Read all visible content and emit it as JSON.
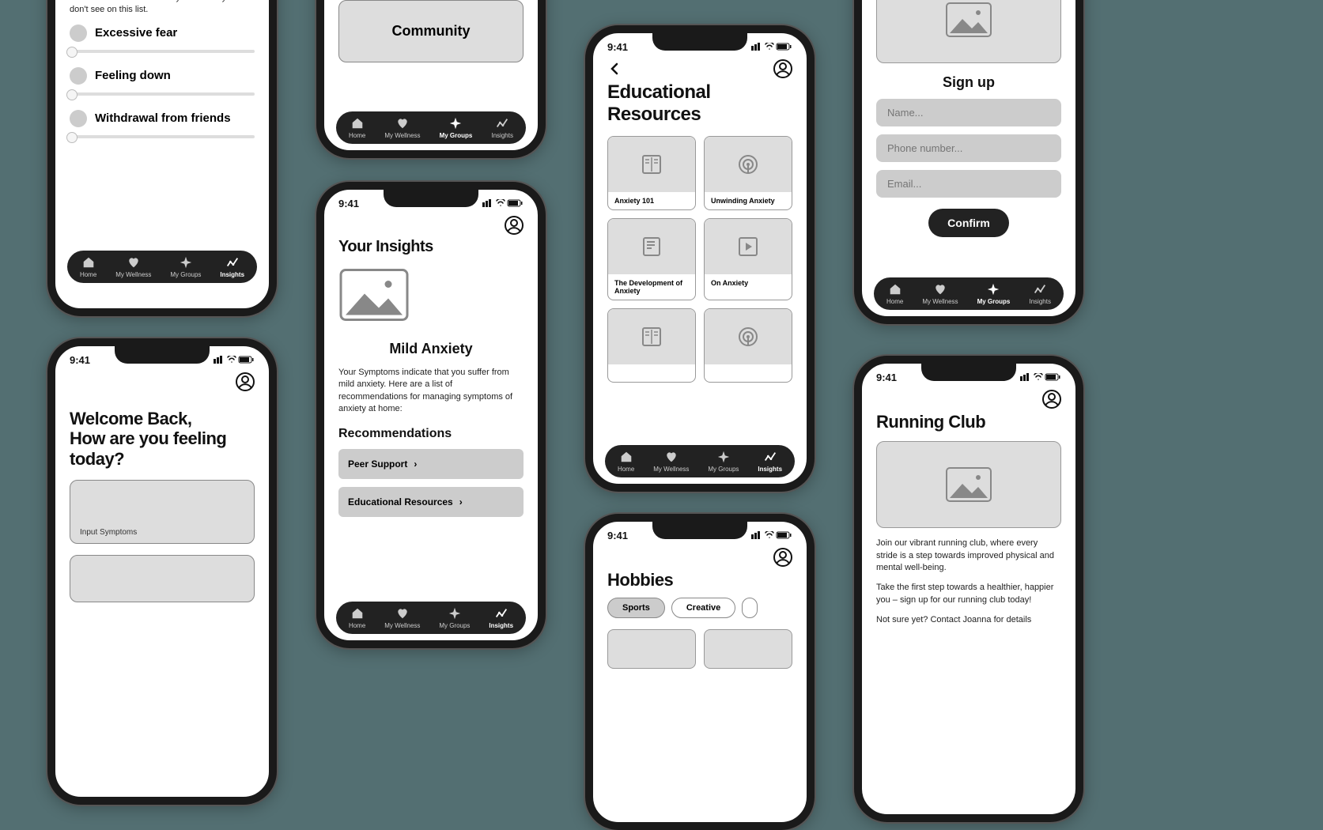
{
  "status_time": "9:41",
  "tabbar": {
    "home": "Home",
    "wellness": "My Wellness",
    "groups": "My Groups",
    "insights": "Insights"
  },
  "screen1": {
    "intro": "can search below to add any more that you don't see on this list.",
    "items": [
      "Excessive fear",
      "Feeling down",
      "Withdrawal from friends"
    ]
  },
  "screen2": {
    "card_label": "Community"
  },
  "screen3": {
    "greeting_line1": "Welcome Back,",
    "greeting_line2": "How are you feeling today?",
    "card_label": "Input Symptoms"
  },
  "screen4": {
    "title": "Your Insights",
    "diagnosis": "Mild Anxiety",
    "body": "Your Symptoms indicate that you suffer from mild anxiety. Here are a list of recommendations for managing symptoms of anxiety at home:",
    "rec_heading": "Recommendations",
    "recs": [
      "Peer Support",
      "Educational Resources"
    ]
  },
  "screen5": {
    "title": "Educational Resources",
    "cards": [
      "Anxiety 101",
      "Unwinding Anxiety",
      "The Development of Anxiety",
      "On Anxiety"
    ]
  },
  "screen6": {
    "title": "Hobbies",
    "pills": [
      "Sports",
      "Creative"
    ]
  },
  "screen7": {
    "title": "Sign up",
    "name_ph": "Name...",
    "phone_ph": "Phone number...",
    "email_ph": "Email...",
    "confirm": "Confirm"
  },
  "screen8": {
    "title": "Running Club",
    "p1": "Join our vibrant running club, where every stride is a step towards improved physical and mental well-being.",
    "p2": "Take the first step towards a healthier, happier you – sign up for our running club today!",
    "p3": "Not sure yet? Contact Joanna for details"
  }
}
